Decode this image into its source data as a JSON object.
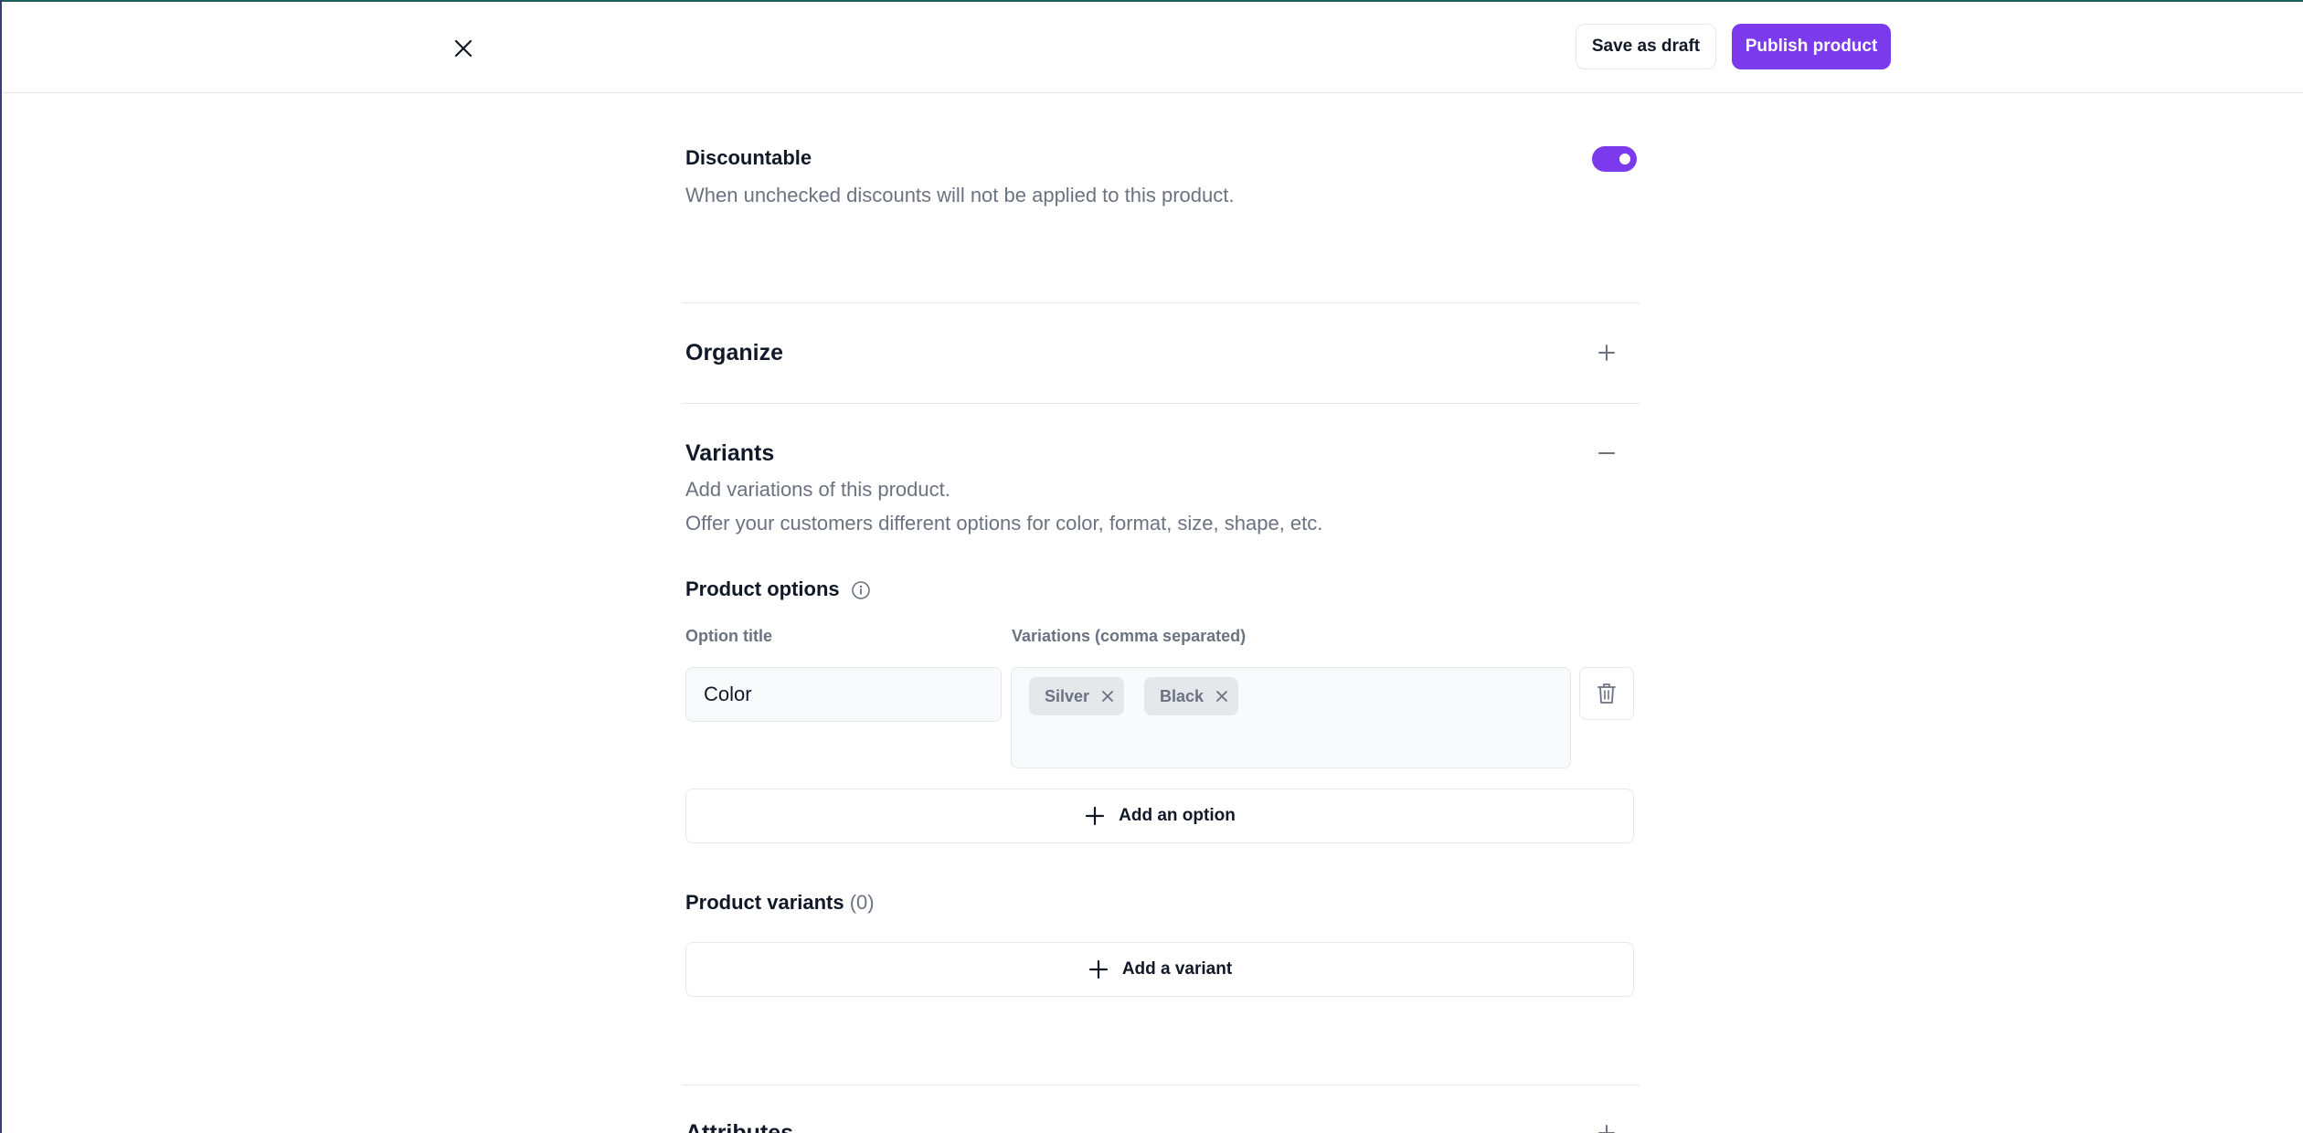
{
  "header": {
    "save_draft_label": "Save as draft",
    "publish_label": "Publish product"
  },
  "discountable": {
    "title": "Discountable",
    "description": "When unchecked discounts will not be applied to this product.",
    "enabled": true
  },
  "organize": {
    "title": "Organize"
  },
  "variants": {
    "title": "Variants",
    "description_1": "Add variations of this product.",
    "description_2": "Offer your customers different options for color, format, size, shape, etc.",
    "product_options_label": "Product options",
    "option_title_label": "Option title",
    "variations_label": "Variations (comma separated)",
    "option": {
      "title_value": "Color",
      "variations": [
        "Silver",
        "Black"
      ]
    },
    "add_option_label": "Add an option",
    "product_variants_label": "Product variants",
    "product_variants_count": "(0)",
    "add_variant_label": "Add a variant"
  },
  "attributes": {
    "title": "Attributes"
  },
  "colors": {
    "accent": "#7c3aed",
    "border": "#e5e7eb",
    "muted_text": "#6b7280"
  }
}
